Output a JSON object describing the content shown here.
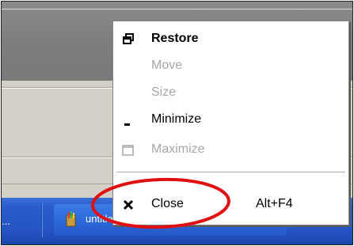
{
  "menu": {
    "items": [
      {
        "label": "Restore",
        "icon": "restore-icon",
        "enabled": true,
        "bold": true
      },
      {
        "label": "Move",
        "enabled": false
      },
      {
        "label": "Size",
        "enabled": false
      },
      {
        "label": "Minimize",
        "icon": "minimize-icon",
        "enabled": true
      },
      {
        "label": "Maximize",
        "icon": "maximize-icon",
        "enabled": false
      },
      {
        "label": "Close",
        "icon": "close-icon",
        "enabled": true,
        "shortcut": "Alt+F4"
      }
    ]
  },
  "taskbar": {
    "truncated_left": "...",
    "button_label": "untitled - Paint"
  },
  "colors": {
    "taskbar_blue": "#2454c4",
    "annotation_red": "#e01010",
    "disabled_text": "#a7a7a7"
  }
}
